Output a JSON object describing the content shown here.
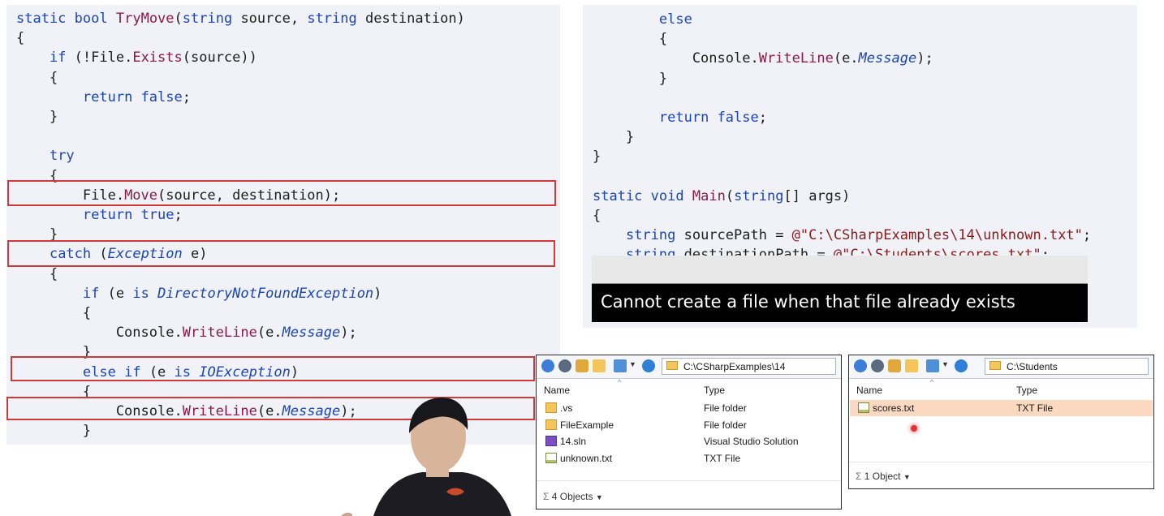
{
  "left_code": {
    "lines": [
      "static bool TryMove(string source, string destination)",
      "{",
      "    if (!File.Exists(source))",
      "    {",
      "        return false;",
      "    }",
      "",
      "    try",
      "    {",
      "        File.Move(source, destination);",
      "        return true;",
      "    }",
      "    catch (Exception e)",
      "    {",
      "        if (e is DirectoryNotFoundException)",
      "        {",
      "            Console.WriteLine(e.Message);",
      "        }",
      "        else if (e is IOException)",
      "        {",
      "            Console.WriteLine(e.Message);",
      "        }"
    ]
  },
  "right_code": {
    "lines": [
      "        else",
      "        {",
      "            Console.WriteLine(e.Message);",
      "        }",
      "",
      "        return false;",
      "    }",
      "}",
      "",
      "static void Main(string[] args)",
      "{",
      "    string sourcePath = @\"C:\\CSharpExamples\\14\\unknown.txt\";",
      "    string destinationPath = @\"C:\\Students\\scores.txt\";"
    ]
  },
  "caption": {
    "text": "Cannot create a file when that file already exists"
  },
  "explorer_left": {
    "address": "C:\\CSharpExamples\\14",
    "col_name": "Name",
    "col_type": "Type",
    "rows": [
      {
        "name": ".vs",
        "type": "File folder",
        "icon": "folder-icon"
      },
      {
        "name": "FileExample",
        "type": "File folder",
        "icon": "folder-icon"
      },
      {
        "name": "14.sln",
        "type": "Visual Studio Solution",
        "icon": "solution-file-icon"
      },
      {
        "name": "unknown.txt",
        "type": "TXT File",
        "icon": "text-file-icon"
      }
    ],
    "status": "4 Objects"
  },
  "explorer_right": {
    "address": "C:\\Students",
    "col_name": "Name",
    "col_type": "Type",
    "rows": [
      {
        "name": "scores.txt",
        "type": "TXT File",
        "icon": "text-file-icon",
        "selected": true
      }
    ],
    "status": "1 Object"
  },
  "colors": {
    "keyword": "#1a45b8",
    "method": "#8b1a4a",
    "highlight_box": "#d23a3a",
    "code_bg": "#f0f2f7",
    "selected_row": "#fad9c0"
  }
}
